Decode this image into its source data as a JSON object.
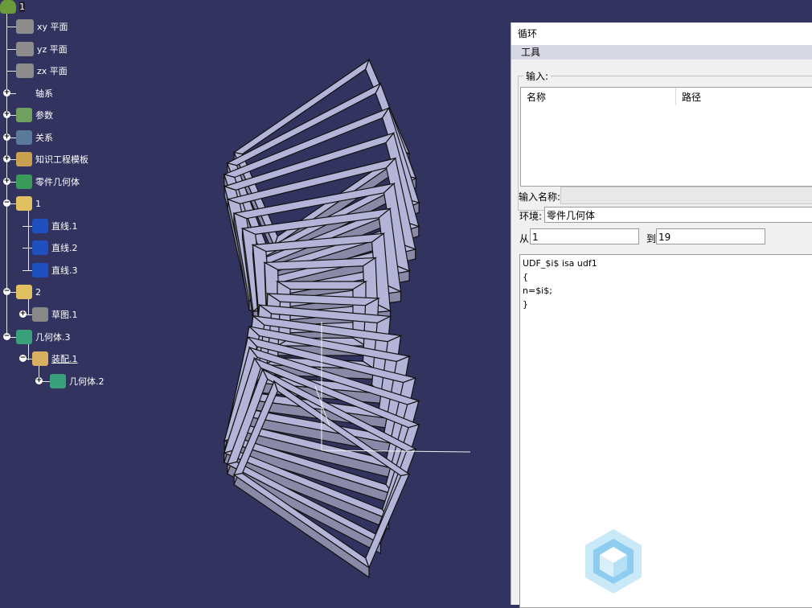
{
  "tree": {
    "root": "1",
    "items": [
      {
        "label": "xy 平面",
        "icon": "plane-icon"
      },
      {
        "label": "yz 平面",
        "icon": "plane-icon"
      },
      {
        "label": "zx 平面",
        "icon": "plane-icon"
      },
      {
        "label": "轴系",
        "icon": "axis-system-icon"
      },
      {
        "label": "参数",
        "icon": "parameters-icon"
      },
      {
        "label": "关系",
        "icon": "relations-icon"
      },
      {
        "label": "知识工程模板",
        "icon": "knowledge-template-icon"
      },
      {
        "label": "零件几何体",
        "icon": "part-body-icon"
      },
      {
        "label": "1",
        "icon": "geometrical-set-icon"
      },
      {
        "label": "直线.1",
        "icon": "line-icon"
      },
      {
        "label": "直线.2",
        "icon": "line-icon"
      },
      {
        "label": "直线.3",
        "icon": "line-icon"
      },
      {
        "label": "2",
        "icon": "geometrical-set-icon"
      },
      {
        "label": "草图.1",
        "icon": "sketch-icon"
      },
      {
        "label": "几何体.3",
        "icon": "body-icon"
      },
      {
        "label": "装配.1",
        "icon": "assemble-icon"
      },
      {
        "label": "几何体.2",
        "icon": "body-icon"
      }
    ]
  },
  "dialog": {
    "title": "循环",
    "menu": "工具",
    "input_group": "输入:",
    "columns": [
      "名称",
      "路径"
    ],
    "input_name_label": "输入名称:",
    "env_label": "环境:",
    "env_value": "零件几何体",
    "from_label": "从",
    "from_value": "1",
    "to_label": "到",
    "to_value": "19",
    "code_lines": [
      "UDF_$i$ isa udf1",
      "{",
      "n=$i$;",
      "}"
    ]
  },
  "colors": {
    "background": "#33335f",
    "model_face": "#b4b4d8",
    "model_side": "#8a8aa8"
  }
}
